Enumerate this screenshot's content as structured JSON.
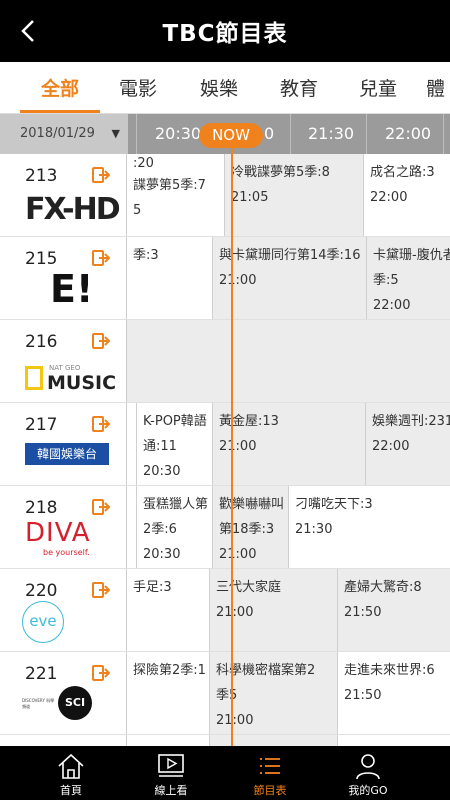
{
  "header": {
    "title": "TBC節目表",
    "back_icon": "chevron-left-icon"
  },
  "tabs": [
    {
      "label": "全部",
      "active": true
    },
    {
      "label": "電影",
      "active": false
    },
    {
      "label": "娛樂",
      "active": false
    },
    {
      "label": "教育",
      "active": false
    },
    {
      "label": "兒童",
      "active": false
    },
    {
      "label": "體",
      "active": false
    }
  ],
  "timebar": {
    "date": "2018/01/29",
    "times": [
      "20:30",
      "0",
      "21:30",
      "22:00"
    ],
    "now_label": "NOW"
  },
  "channels": [
    {
      "number": "213",
      "logo": "FX-HD",
      "programs": [
        {
          "lines": [
            ":20",
            "諜夢第5季:7",
            "5"
          ]
        },
        {
          "lines": [
            "冷戰諜夢第5季:8",
            "21:05"
          ]
        },
        {
          "lines": [
            "成名之路:3",
            "22:00"
          ]
        }
      ]
    },
    {
      "number": "215",
      "logo": "E!",
      "programs": [
        {
          "lines": [
            "季:3"
          ]
        },
        {
          "lines": [
            "與卡黛珊同行第14季:16",
            "21:00"
          ]
        },
        {
          "lines": [
            "卡黛珊-腹仇者",
            "季:5",
            "22:00"
          ]
        }
      ]
    },
    {
      "number": "216",
      "logo_top": "NAT GEO",
      "logo": "MUSIC",
      "programs": []
    },
    {
      "number": "217",
      "logo": "韓國娛樂台",
      "programs": [
        {
          "lines": [
            "K-POP韓語",
            "通:11",
            "20:30"
          ]
        },
        {
          "lines": [
            "黃金屋:13",
            "21:00"
          ]
        },
        {
          "lines": [
            "娛樂週刊:231",
            "22:00"
          ]
        }
      ]
    },
    {
      "number": "218",
      "logo": "DIVA",
      "logo_sub": "be yourself.",
      "programs": [
        {
          "lines": [
            "蛋糕獵人第",
            "2季:6",
            "20:30"
          ]
        },
        {
          "lines": [
            "歡樂嚇嚇叫",
            "第18季:3",
            "21:00"
          ]
        },
        {
          "lines": [
            "刁嘴吃天下:3",
            "21:30"
          ]
        }
      ]
    },
    {
      "number": "220",
      "logo": "eve",
      "programs": [
        {
          "lines": [
            "手足:3"
          ]
        },
        {
          "lines": [
            "三代大家庭",
            "21:00"
          ]
        },
        {
          "lines": [
            "產婦大驚奇:8",
            "21:50"
          ]
        }
      ]
    },
    {
      "number": "221",
      "logo": "SCI",
      "logo_sub": "DISCOVERY 科學頻道",
      "programs": [
        {
          "lines": [
            "探險第2季:1"
          ]
        },
        {
          "lines": [
            "科學機密檔案第2",
            "季5",
            "21:00"
          ]
        },
        {
          "lines": [
            "走進未來世界:6",
            "21:50"
          ]
        }
      ]
    }
  ],
  "bottom_nav": [
    {
      "label": "首頁",
      "icon": "home-icon",
      "active": false
    },
    {
      "label": "線上看",
      "icon": "play-screen-icon",
      "active": false
    },
    {
      "label": "節目表",
      "icon": "list-icon",
      "active": true
    },
    {
      "label": "我的GO",
      "icon": "person-icon",
      "active": false
    }
  ],
  "colors": {
    "accent": "#f0821e",
    "bar": "#000000",
    "grey_cell": "#ececec"
  }
}
